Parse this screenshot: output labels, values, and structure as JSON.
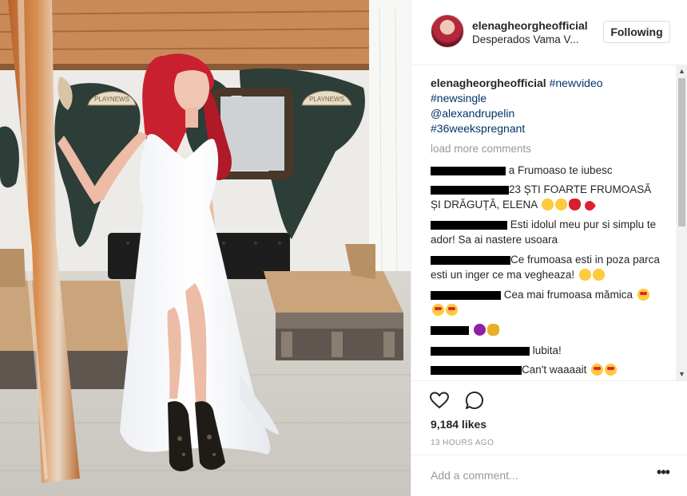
{
  "photo": {
    "sign_left": "PLAYNEWS",
    "sign_right": "PLAYNEWS"
  },
  "header": {
    "username": "elenagheorgheofficial",
    "location": "Desperados Vama V...",
    "follow_label": "Following"
  },
  "caption": {
    "username": "elenagheorgheofficial",
    "tags": [
      "#newvideo",
      "#newsingle",
      "@alexandrupelin",
      "#36weekspregnant"
    ]
  },
  "load_more": "load more comments",
  "comments": [
    {
      "text": "a Frumoaso te iubesc",
      "emojis": []
    },
    {
      "text": "23 ȘTI FOARTE FRUMOASĂ ȘI DRĂGUȚĂ, ELENA",
      "emojis": [
        "smile",
        "smile",
        "rose",
        "heart"
      ]
    },
    {
      "text": "Esti idolul meu pur si simplu te ador! Sa ai nastere usoara",
      "emojis": []
    },
    {
      "text": "Ce frumoasa esti in poza parca esti un inger ce ma vegheaza!",
      "emojis": [
        "smile",
        "smile"
      ]
    },
    {
      "text": "Cea mai frumoasa mămica",
      "emojis": [
        "heart-eyes",
        "heart-eyes",
        "heart-eyes"
      ]
    },
    {
      "text": "",
      "emojis": [
        "devil",
        "money-bag"
      ]
    },
    {
      "text": "lubita!",
      "emojis": []
    },
    {
      "text": "Can't waaaait",
      "emojis": [
        "heart-eyes",
        "heart-eyes"
      ]
    }
  ],
  "actions": {
    "like_icon": "heart-outline-icon",
    "comment_icon": "comment-bubble-icon",
    "likes": "9,184 likes",
    "time": "13 HOURS AGO"
  },
  "add_comment": {
    "placeholder": "Add a comment...",
    "more_icon": "more-options-icon"
  },
  "colors": {
    "link": "#003569",
    "muted": "#999999",
    "border": "#efefef",
    "hair": "#c8202f"
  }
}
